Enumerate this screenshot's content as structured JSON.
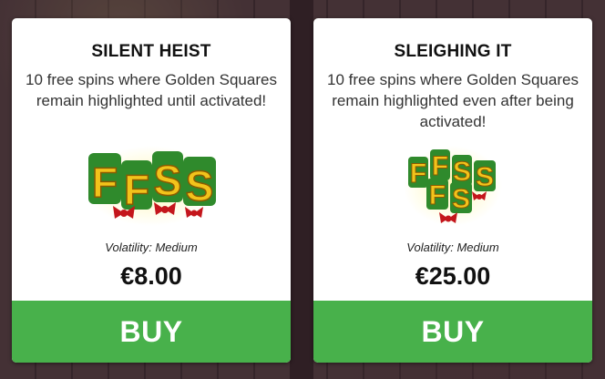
{
  "cards": [
    {
      "title": "SILENT HEIST",
      "description": "10 free spins where Golden Squares remain highlighted until activated!",
      "volatility": "Volatility: Medium",
      "price": "€8.00",
      "buy_label": "BUY",
      "art_icon": "free-spins-fs-logo",
      "art_letters": [
        "F",
        "F",
        "S",
        "S"
      ]
    },
    {
      "title": "SLEIGHING IT",
      "description": "10 free spins where Golden Squares remain highlighted even after being activated!",
      "volatility": "Volatility: Medium",
      "price": "€25.00",
      "buy_label": "BUY",
      "art_icon": "free-spins-fs-stacked-logo",
      "art_letters": [
        "F",
        "F",
        "S",
        "S",
        "F",
        "S"
      ]
    }
  ],
  "colors": {
    "buy_button": "#48b14b",
    "letter_gold": "#f2c31b",
    "letter_green": "#2f8a2c",
    "bow_red": "#c4161c"
  }
}
